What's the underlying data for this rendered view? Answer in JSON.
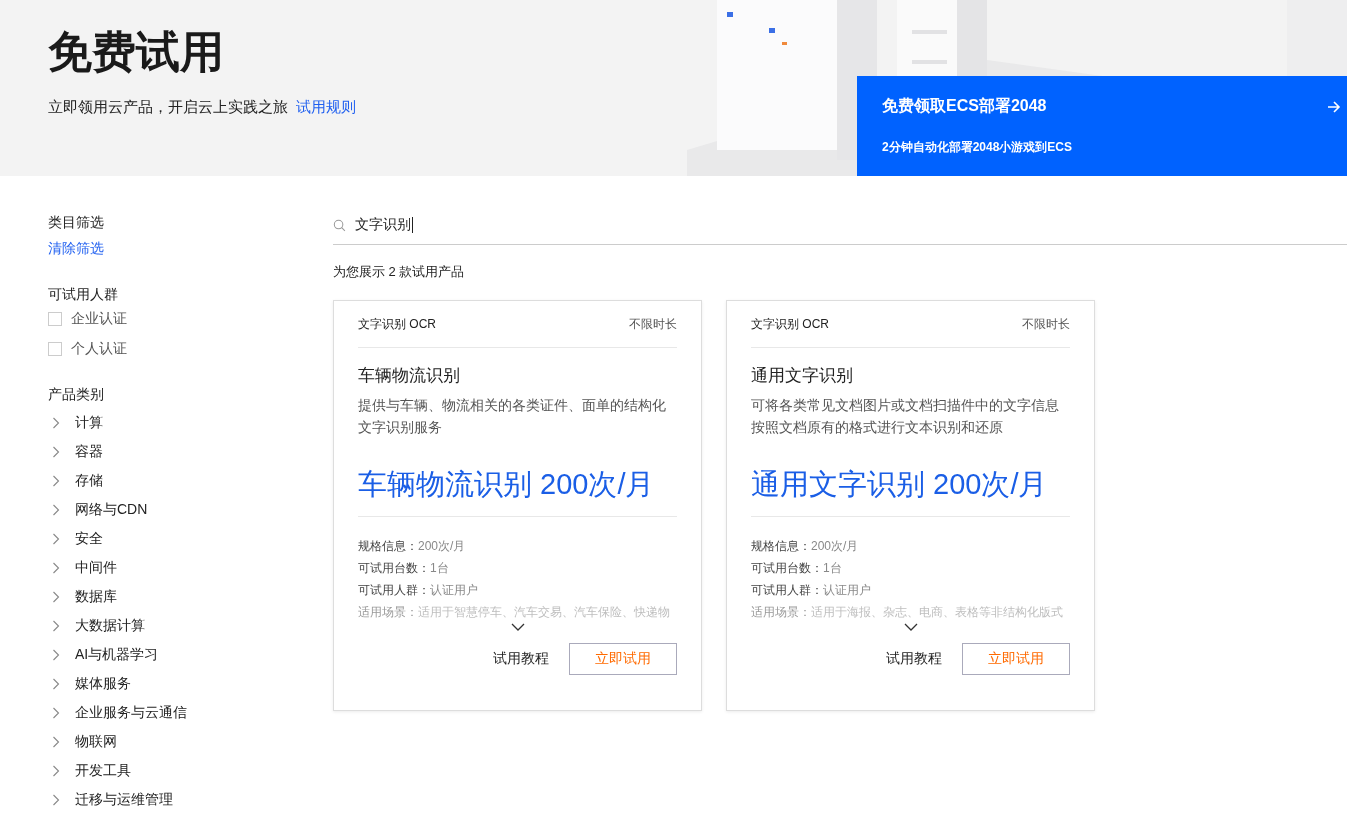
{
  "header": {
    "title": "免费试用",
    "subtitle": "立即领用云产品，开启云上实践之旅",
    "rules_link": "试用规则",
    "kind": "picture"
  },
  "promo": {
    "title": "免费领取ECS部署2048",
    "subtitle": "2分钟自动化部署2048小游戏到ECS"
  },
  "sidebar": {
    "heading": "类目筛选",
    "clear_link": "清除筛选",
    "audience": {
      "heading": "可试用人群",
      "options": [
        {
          "label": "企业认证",
          "checked": false
        },
        {
          "label": "个人认证",
          "checked": false
        }
      ]
    },
    "categories": {
      "heading": "产品类别",
      "items": [
        {
          "label": "计算",
          "expanded": false
        },
        {
          "label": "容器",
          "expanded": false
        },
        {
          "label": "存储",
          "expanded": false
        },
        {
          "label": "网络与CDN",
          "expanded": false
        },
        {
          "label": "安全",
          "expanded": false
        },
        {
          "label": "中间件",
          "expanded": false
        },
        {
          "label": "数据库",
          "expanded": false
        },
        {
          "label": "大数据计算",
          "expanded": false
        },
        {
          "label": "AI与机器学习",
          "expanded": false
        },
        {
          "label": "媒体服务",
          "expanded": false
        },
        {
          "label": "企业服务与云通信",
          "expanded": false
        },
        {
          "label": "物联网",
          "expanded": false
        },
        {
          "label": "开发工具",
          "expanded": false
        },
        {
          "label": "迁移与运维管理",
          "expanded": false
        }
      ]
    }
  },
  "search": {
    "value": "文字识别"
  },
  "result_count": "为您展示 2 款试用产品",
  "products": [
    {
      "category": "文字识别 OCR",
      "duration": "不限时长",
      "name": "车辆物流识别",
      "description": "提供与车辆、物流相关的各类证件、面单的结构化文字识别服务",
      "offer": "车辆物流识别 200次/月",
      "details": [
        {
          "label": "规格信息：",
          "value": "200次/月"
        },
        {
          "label": "可试用台数：",
          "value": "1台"
        },
        {
          "label": "可试用人群：",
          "value": "认证用户"
        },
        {
          "label": "适用场景：",
          "value": "适用于智慧停车、汽车交易、汽车保险、快递物"
        }
      ],
      "expanded": false,
      "tutorial": "试用教程",
      "try_button": "立即试用"
    },
    {
      "category": "文字识别 OCR",
      "duration": "不限时长",
      "name": "通用文字识别",
      "description": "可将各类常见文档图片或文档扫描件中的文字信息按照文档原有的格式进行文本识别和还原",
      "offer": "通用文字识别 200次/月",
      "details": [
        {
          "label": "规格信息：",
          "value": "200次/月"
        },
        {
          "label": "可试用台数：",
          "value": "1台"
        },
        {
          "label": "可试用人群：",
          "value": "认证用户"
        },
        {
          "label": "适用场景：",
          "value": "适用于海报、杂志、电商、表格等非结构化版式"
        }
      ],
      "expanded": false,
      "tutorial": "试用教程",
      "try_button": "立即试用"
    }
  ]
}
